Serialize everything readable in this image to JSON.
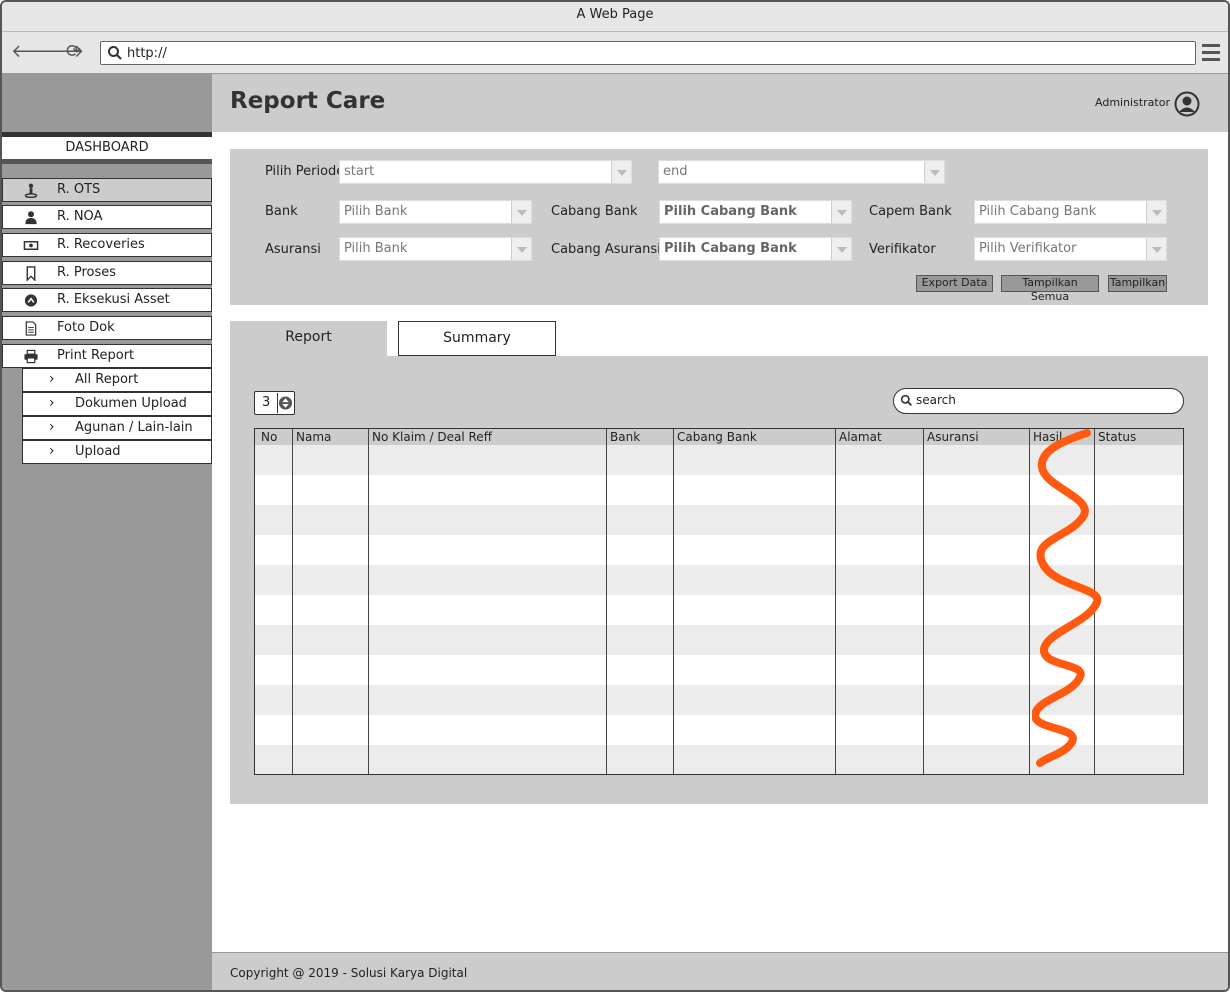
{
  "window": {
    "title": "A Web Page",
    "url": "http://"
  },
  "sidebar": {
    "dashboard_label": "DASHBOARD",
    "items": [
      {
        "label": "R. OTS",
        "icon": "person-pin-icon"
      },
      {
        "label": "R. NOA",
        "icon": "user-icon"
      },
      {
        "label": "R. Recoveries",
        "icon": "money-icon"
      },
      {
        "label": "R. Proses",
        "icon": "bookmark-icon"
      },
      {
        "label": "R. Eksekusi Asset",
        "icon": "upload-circle-icon"
      },
      {
        "label": "Foto Dok",
        "icon": "document-icon"
      },
      {
        "label": "Print Report",
        "icon": "printer-icon"
      }
    ],
    "subitems": [
      {
        "label": "All Report"
      },
      {
        "label": "Dokumen Upload"
      },
      {
        "label": "Agunan / Lain-lain"
      },
      {
        "label": "Upload"
      }
    ]
  },
  "header": {
    "title": "Report Care",
    "user": "Administrator"
  },
  "filters": {
    "periode_label": "Pilih Periode",
    "start_value": "start",
    "end_value": "end",
    "bank_label": "Bank",
    "bank_value": "Pilih Bank",
    "cabang_bank_label": "Cabang Bank",
    "cabang_bank_value": "Pilih Cabang Bank",
    "capem_bank_label": "Capem Bank",
    "capem_bank_value": "Pilih Cabang Bank",
    "asuransi_label": "Asuransi",
    "asuransi_value": "Pilih Bank",
    "cabang_asuransi_label": "Cabang Asuransi",
    "cabang_asuransi_value": "Pilih Cabang Bank",
    "verifikator_label": "Verifikator",
    "verifikator_value": "Pilih Verifikator",
    "export_button": "Export Data",
    "show_all_button": "Tampilkan Semua",
    "show_button": "Tampilkan"
  },
  "tabs": {
    "report": "Report",
    "summary": "Summary"
  },
  "table": {
    "page_size": "3",
    "search_placeholder": "search",
    "columns": [
      "No",
      "Nama",
      "No Klaim / Deal Reff",
      "Bank",
      "Cabang Bank",
      "Alamat",
      "Asuransi",
      "Hasil",
      "Status"
    ],
    "rows": []
  },
  "annotation": {
    "color": "#ff5a0f"
  },
  "footer": {
    "copyright": "Copyright @ 2019 - Solusi Karya Digital"
  }
}
